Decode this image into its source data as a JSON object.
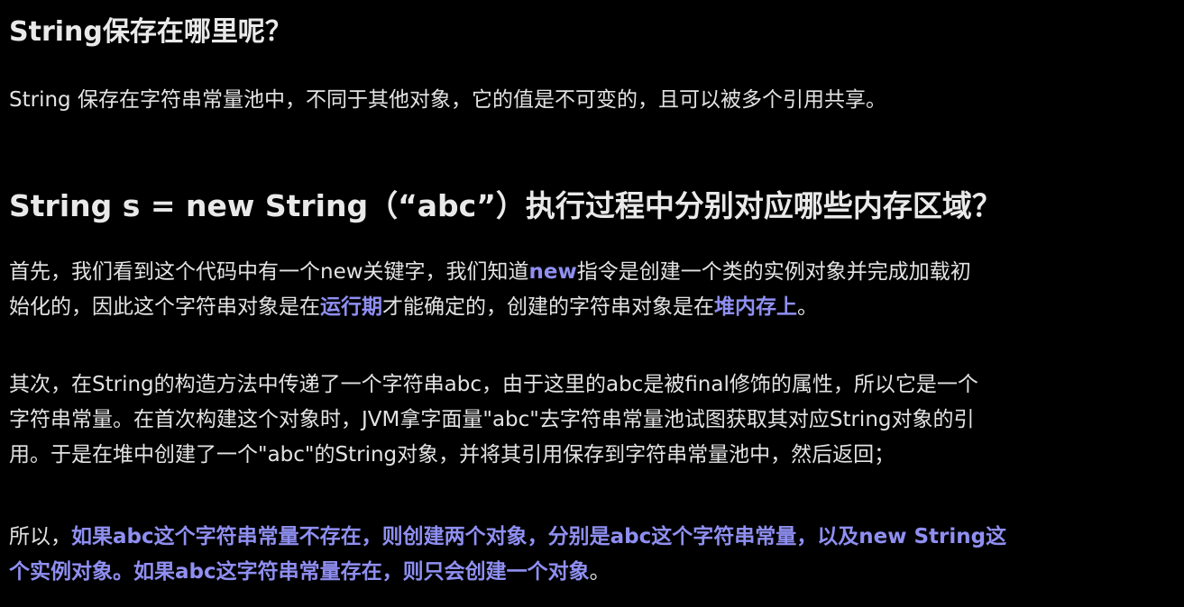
{
  "section1": {
    "heading": "String保存在哪里呢？",
    "paragraph": "String 保存在字符串常量池中，不同于其他对象，它的值是不可变的，且可以被多个引用共享。"
  },
  "section2": {
    "heading": "String s = new String（“abc”）执行过程中分别对应哪些内存区域？",
    "p1": {
      "line1_a": "首先，我们看到这个代码中有一个new关键字，我们知道",
      "line1_b": "new",
      "line1_c": "指令是创建一个类的实例对象并完成加载初",
      "line2_a": "始化的，因此这个字符串对象是在",
      "line2_b": "运行期",
      "line2_c": "才能确定的，创建的字符串对象是在",
      "line2_d": "堆内存上",
      "line2_e": "。"
    },
    "p2": {
      "line1": "其次，在String的构造方法中传递了一个字符串abc，由于这里的abc是被final修饰的属性，所以它是一个",
      "line2": "字符串常量。在首次构建这个对象时，JVM拿字面量\"abc\"去字符串常量池试图获取其对应String对象的引",
      "line3": "用。于是在堆中创建了一个\"abc\"的String对象，并将其引用保存到字符串常量池中，然后返回；"
    },
    "p3": {
      "line1_a": "所以，",
      "line1_b": "如果abc这个字符串常量不存在，则创建两个对象，分别是abc这个字符串常量，以及new String这",
      "line2_a": "个实例对象。如果abc这字符串常量存在，则只会创建一个对象",
      "line2_b": "。"
    }
  },
  "colors": {
    "background": "#000000",
    "text": "#e3e3e3",
    "highlight": "#8f8ff2"
  }
}
